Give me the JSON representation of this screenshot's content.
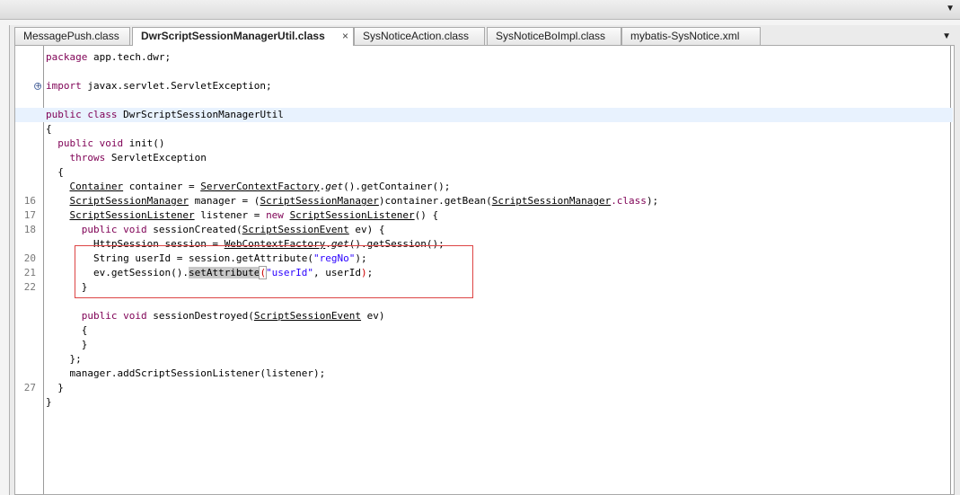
{
  "editor": {
    "tabs": [
      {
        "label": "MessagePush.class",
        "active": false
      },
      {
        "label": "DwrScriptSessionManagerUtil.class",
        "active": true
      },
      {
        "label": "SysNoticeAction.class",
        "active": false
      },
      {
        "label": "SysNoticeBoImpl.class",
        "active": false
      },
      {
        "label": "mybatis-SysNotice.xml",
        "active": false
      }
    ],
    "close_glyph": "×",
    "line_numbers": {
      "l16": "16",
      "l17": "17",
      "l18": "18",
      "l20": "20",
      "l21": "21",
      "l22": "22",
      "l27": "27"
    },
    "fold_glyph": "+",
    "annotation_color": "#dd4444"
  },
  "code": {
    "package_kw": "package",
    "package_name": " app.tech.dwr;",
    "import_kw": "import",
    "import_name": " javax.servlet.ServletException;",
    "public_kw": "public",
    "class_kw": "class",
    "class_name": " DwrScriptSessionManagerUtil",
    "brace_open": "{",
    "brace_close": "}",
    "void_kw": "void",
    "init_sig": " init()",
    "throws_kw": "throws",
    "throws_type": " ServletException",
    "container_type": "Container",
    "container_decl": " container = ",
    "scf": "ServerContextFactory",
    "get": "get",
    "get_container": "().getContainer();",
    "ssm_type": "ScriptSessionManager",
    "manager_decl": " manager = (",
    "container_getbean": ")container.getBean(",
    "class_suffix": ".class",
    "close_paren_semi": ");",
    "ssl_type": "ScriptSessionListener",
    "listener_decl": " listener = ",
    "new_kw": "new",
    "ssl_ctor": "() {",
    "session_created": " sessionCreated(",
    "sse_type": "ScriptSessionEvent",
    "ev_open": " ev) {",
    "http_session_line": "HttpSession session = ",
    "wcf": "WebContextFactory",
    "get_session": "().getSession();",
    "string_line": "String userId = session.getAttribute(",
    "reg_no": "\"regNo\"",
    "ev_get_session": "ev.getSession().",
    "set_attribute": "setAttribute",
    "paren_open": "(",
    "user_id_str": "\"userId\"",
    "user_id_arg": ", userId",
    "paren_close": ")",
    "semi": ";",
    "session_destroyed": " sessionDestroyed(",
    "ev_close": " ev)",
    "close_semi": "};",
    "add_listener": "manager.addScriptSessionListener(listener);"
  }
}
